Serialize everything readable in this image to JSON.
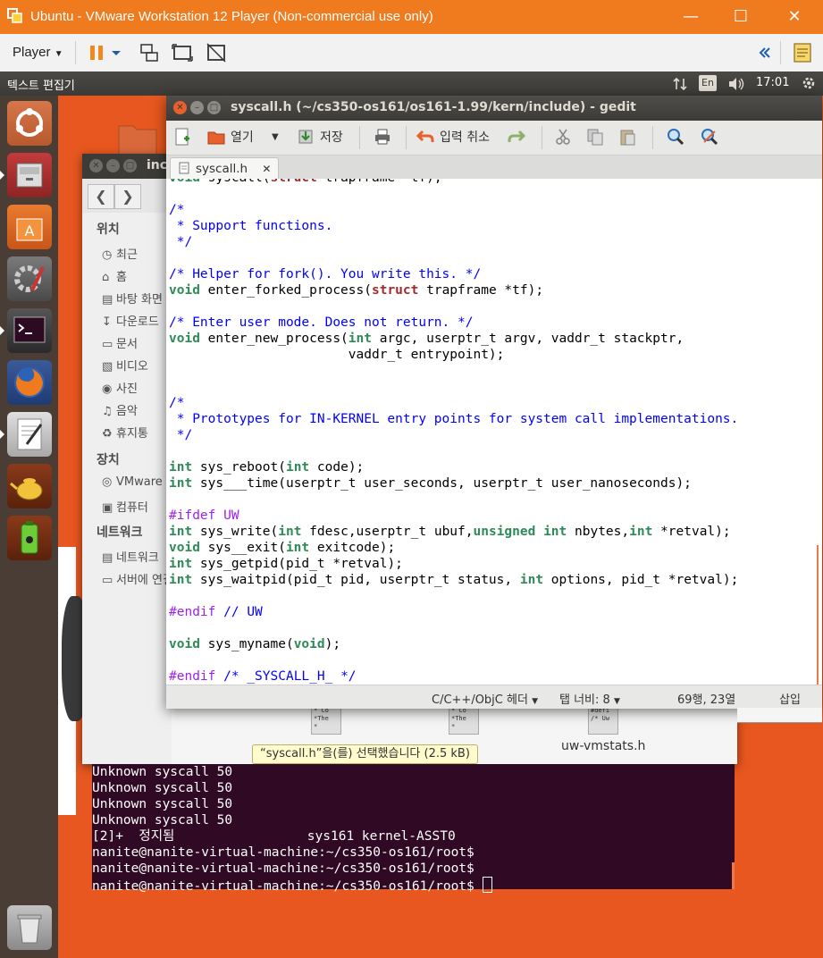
{
  "vmware": {
    "title": "Ubuntu - VMware Workstation 12 Player (Non-commercial use only)",
    "player_menu": "Player",
    "window_controls": [
      "minimize",
      "maximize",
      "close"
    ]
  },
  "ubuntu_panel": {
    "app_name": "텍스트 편집기",
    "lang": "En",
    "clock": "17:01"
  },
  "launcher": {
    "items": [
      "ubuntu-dash",
      "files",
      "software-center",
      "system-settings",
      "terminal",
      "firefox",
      "text-editor",
      "teapot-app",
      "battery-app",
      "trash"
    ]
  },
  "nautilus": {
    "title": "inc",
    "sidebar": {
      "places_header": "위치",
      "places": [
        "최근",
        "홈",
        "바탕 화면",
        "다운로드",
        "문서",
        "비디오",
        "사진",
        "음악",
        "휴지통"
      ],
      "devices_header": "장치",
      "devices": [
        "VMware",
        "컴퓨터"
      ],
      "network_header": "네트워크",
      "network": [
        "네트워크",
        "서버에 연결"
      ]
    },
    "files": [
      {
        "thumb": "* Co\n*The\n*",
        "name": ""
      },
      {
        "thumb": "* Co\n*The\n*",
        "name": ""
      },
      {
        "thumb": "#defi\n/* Uw",
        "name": "uw-vmstats.h"
      }
    ],
    "status": "“syscall.h”을(를) 선택했습니다 (2.5 kB)"
  },
  "terminal": {
    "lines": [
      "Unknown syscall 50",
      "Unknown syscall 50",
      "Unknown syscall 50",
      "Unknown syscall 50",
      "[2]+  정지됨                 sys161 kernel-ASST0",
      "nanite@nanite-virtual-machine:~/cs350-os161/root$",
      "nanite@nanite-virtual-machine:~/cs350-os161/root$",
      "nanite@nanite-virtual-machine:~/cs350-os161/root$ "
    ]
  },
  "gedit": {
    "title": "syscall.h (~/cs350-os161/os161-1.99/kern/include) - gedit",
    "toolbar": {
      "open": "열기",
      "save": "저장",
      "undo": "입력 취소"
    },
    "tab_label": "syscall.h",
    "code": [
      [
        [
          "ty",
          "void"
        ],
        [
          "n",
          " syscall("
        ],
        [
          "st",
          "struct"
        ],
        [
          "n",
          " trapframe *tf);"
        ]
      ],
      [
        [
          "n",
          ""
        ]
      ],
      [
        [
          "cm",
          "/*"
        ]
      ],
      [
        [
          "cm",
          " * Support functions."
        ]
      ],
      [
        [
          "cm",
          " */"
        ]
      ],
      [
        [
          "n",
          ""
        ]
      ],
      [
        [
          "cm",
          "/* Helper for fork(). You write this. */"
        ]
      ],
      [
        [
          "ty",
          "void"
        ],
        [
          "n",
          " enter_forked_process("
        ],
        [
          "st",
          "struct"
        ],
        [
          "n",
          " trapframe *tf);"
        ]
      ],
      [
        [
          "n",
          ""
        ]
      ],
      [
        [
          "cm",
          "/* Enter user mode. Does not return. */"
        ]
      ],
      [
        [
          "ty",
          "void"
        ],
        [
          "n",
          " enter_new_process("
        ],
        [
          "ty",
          "int"
        ],
        [
          "n",
          " argc, userptr_t argv, vaddr_t stackptr,"
        ]
      ],
      [
        [
          "n",
          "                       vaddr_t entrypoint);"
        ]
      ],
      [
        [
          "n",
          ""
        ]
      ],
      [
        [
          "n",
          ""
        ]
      ],
      [
        [
          "cm",
          "/*"
        ]
      ],
      [
        [
          "cm",
          " * Prototypes for IN-KERNEL entry points for system call implementations."
        ]
      ],
      [
        [
          "cm",
          " */"
        ]
      ],
      [
        [
          "n",
          ""
        ]
      ],
      [
        [
          "ty",
          "int"
        ],
        [
          "n",
          " sys_reboot("
        ],
        [
          "ty",
          "int"
        ],
        [
          "n",
          " code);"
        ]
      ],
      [
        [
          "ty",
          "int"
        ],
        [
          "n",
          " sys___time(userptr_t user_seconds, userptr_t user_nanoseconds);"
        ]
      ],
      [
        [
          "n",
          ""
        ]
      ],
      [
        [
          "pp",
          "#ifdef UW"
        ]
      ],
      [
        [
          "ty",
          "int"
        ],
        [
          "n",
          " sys_write("
        ],
        [
          "ty",
          "int"
        ],
        [
          "n",
          " fdesc,userptr_t ubuf,"
        ],
        [
          "ty",
          "unsigned"
        ],
        [
          "n",
          " "
        ],
        [
          "ty",
          "int"
        ],
        [
          "n",
          " nbytes,"
        ],
        [
          "ty",
          "int"
        ],
        [
          "n",
          " *retval);"
        ]
      ],
      [
        [
          "ty",
          "void"
        ],
        [
          "n",
          " sys__exit("
        ],
        [
          "ty",
          "int"
        ],
        [
          "n",
          " exitcode);"
        ]
      ],
      [
        [
          "ty",
          "int"
        ],
        [
          "n",
          " sys_getpid(pid_t *retval);"
        ]
      ],
      [
        [
          "ty",
          "int"
        ],
        [
          "n",
          " sys_waitpid(pid_t pid, userptr_t status, "
        ],
        [
          "ty",
          "int"
        ],
        [
          "n",
          " options, pid_t *retval);"
        ]
      ],
      [
        [
          "n",
          ""
        ]
      ],
      [
        [
          "pp",
          "#endif"
        ],
        [
          "n",
          " "
        ],
        [
          "cm",
          "// UW"
        ]
      ],
      [
        [
          "n",
          ""
        ]
      ],
      [
        [
          "ty",
          "void"
        ],
        [
          "n",
          " sys_myname("
        ],
        [
          "ty",
          "void"
        ],
        [
          "n",
          ");"
        ]
      ],
      [
        [
          "n",
          ""
        ]
      ],
      [
        [
          "pp",
          "#endif"
        ],
        [
          "n",
          " "
        ],
        [
          "cm",
          "/* _SYSCALL_H_ */"
        ]
      ]
    ],
    "status": {
      "language": "C/C++/ObjC 헤더",
      "tab_width": "탭 너비: 8",
      "position": "69행, 23열",
      "mode": "삽입"
    }
  }
}
